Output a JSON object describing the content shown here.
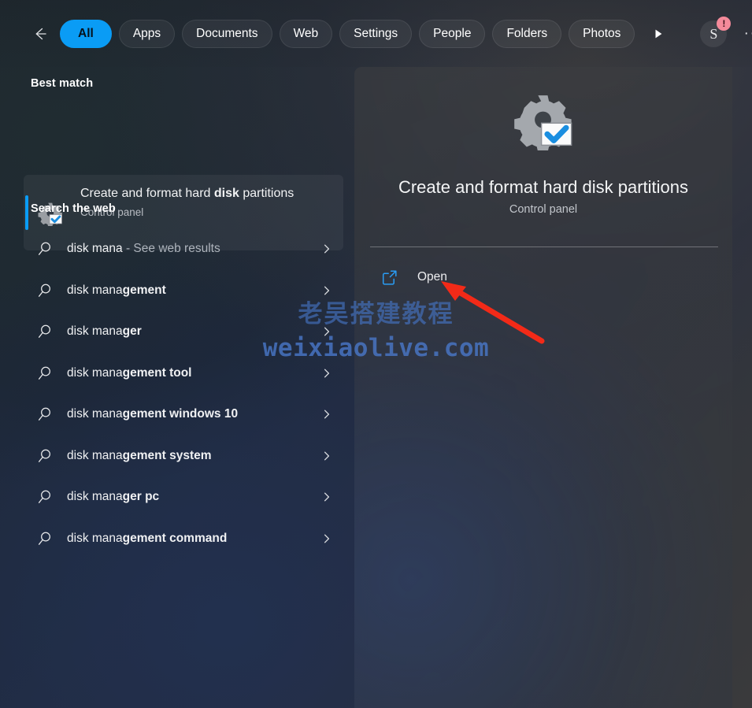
{
  "navbar": {
    "back_icon": "back-arrow-icon",
    "tabs": [
      {
        "label": "All",
        "active": true
      },
      {
        "label": "Apps",
        "active": false
      },
      {
        "label": "Documents",
        "active": false
      },
      {
        "label": "Web",
        "active": false
      },
      {
        "label": "Settings",
        "active": false
      },
      {
        "label": "People",
        "active": false
      },
      {
        "label": "Folders",
        "active": false
      },
      {
        "label": "Photos",
        "active": false
      }
    ],
    "more_tabs_icon": "play-triangle-icon",
    "account": {
      "initial": "S",
      "badge": "!",
      "badge_color": "#f48a9a"
    },
    "more_label": "···"
  },
  "left": {
    "best_match_heading": "Best match",
    "best_match": {
      "title_plain": "Create and format hard ",
      "title_bold": "disk",
      "title_rest": " partitions",
      "subtitle": "Control panel",
      "icon": "disk-management-gear-icon",
      "accent_color": "#0a9cf5"
    },
    "web_heading": "Search the web",
    "query": "disk mana",
    "suggestions": [
      {
        "typed": "disk mana",
        "completion": "",
        "suffix": " - See web results",
        "icon": "search-icon",
        "chevron": "chevron-right-icon"
      },
      {
        "typed": "disk mana",
        "completion": "gement",
        "suffix": "",
        "icon": "search-icon",
        "chevron": "chevron-right-icon"
      },
      {
        "typed": "disk mana",
        "completion": "ger",
        "suffix": "",
        "icon": "search-icon",
        "chevron": "chevron-right-icon"
      },
      {
        "typed": "disk mana",
        "completion": "gement tool",
        "suffix": "",
        "icon": "search-icon",
        "chevron": "chevron-right-icon"
      },
      {
        "typed": "disk mana",
        "completion": "gement windows 10",
        "suffix": "",
        "icon": "search-icon",
        "chevron": "chevron-right-icon"
      },
      {
        "typed": "disk mana",
        "completion": "gement system",
        "suffix": "",
        "icon": "search-icon",
        "chevron": "chevron-right-icon"
      },
      {
        "typed": "disk mana",
        "completion": "ger pc",
        "suffix": "",
        "icon": "search-icon",
        "chevron": "chevron-right-icon"
      },
      {
        "typed": "disk mana",
        "completion": "gement command",
        "suffix": "",
        "icon": "search-icon",
        "chevron": "chevron-right-icon"
      }
    ]
  },
  "preview": {
    "icon": "disk-management-gear-icon",
    "title": "Create and format hard disk partitions",
    "subtitle": "Control panel",
    "open_label": "Open",
    "open_icon": "external-link-icon",
    "open_icon_color": "#2a9df4"
  },
  "watermark": {
    "line1": "老吴搭建教程",
    "line2": "weixiaolive.com"
  },
  "annotation": {
    "arrow_color": "#f22a18",
    "points_to": "Open"
  }
}
